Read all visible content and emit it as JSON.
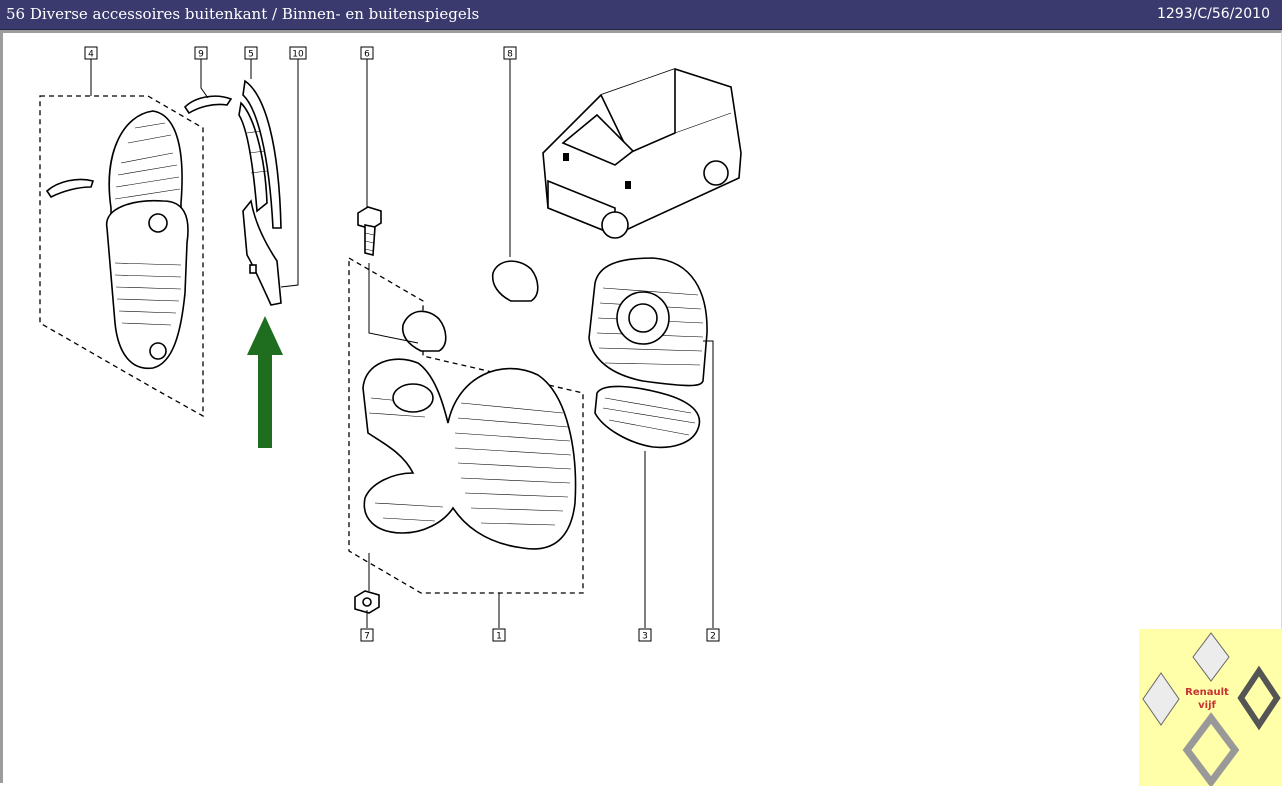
{
  "header": {
    "title": "56 Diverse accessoires buitenkant / Binnen- en buitenspiegels",
    "reference": "1293/C/56/2010"
  },
  "callouts": [
    {
      "id": "4",
      "label": "4"
    },
    {
      "id": "9",
      "label": "9"
    },
    {
      "id": "5",
      "label": "5"
    },
    {
      "id": "10",
      "label": "10"
    },
    {
      "id": "6",
      "label": "6"
    },
    {
      "id": "8",
      "label": "8"
    },
    {
      "id": "7",
      "label": "7"
    },
    {
      "id": "1",
      "label": "1"
    },
    {
      "id": "3",
      "label": "3"
    },
    {
      "id": "2",
      "label": "2"
    }
  ],
  "watermark": {
    "brand_line1": "Renault",
    "brand_line2": "vijf",
    "logo_icon": "renault-diamond-icon",
    "background": "#ffffaa",
    "text_color": "#c83232"
  },
  "colors": {
    "title_bar": "#3a3a6e",
    "arrow": "#1f6e1f"
  }
}
